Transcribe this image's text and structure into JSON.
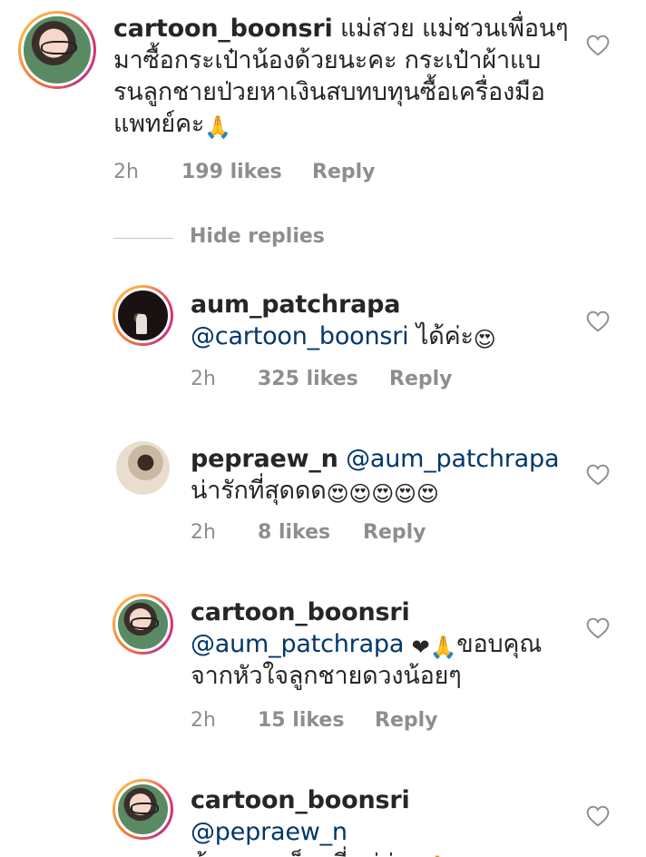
{
  "comments": [
    {
      "username": "cartoon_boonsri",
      "text_line1": "แม่สวย แม่ชวนเพื่อนๆ",
      "text_line2": "มาซื้อกระเป๋าน้องด้วยนะคะ กระเป๋าผ้าแบ",
      "text_line3": "รนลูกชายป่วยหาเงินสบทบทุนซื้อเครื่องมือ",
      "text_line4": "แพทย์คะ",
      "emoji": "🙏",
      "time": "2h",
      "likes": "199 likes",
      "reply": "Reply",
      "avatar": "cartoon-avatar-icon"
    },
    {
      "username": "aum_patchrapa",
      "mention": "@cartoon_boonsri",
      "text": "ได้ค่ะ",
      "emoji": "😍",
      "time": "2h",
      "likes": "325 likes",
      "reply": "Reply",
      "avatar": "aum-avatar-icon"
    },
    {
      "username": "pepraew_n",
      "mention": "@aum_patchrapa",
      "text": "น่ารักที่สุดดด",
      "emoji": "😍😍😍😍😍",
      "time": "2h",
      "likes": "8 likes",
      "reply": "Reply",
      "avatar": "pepraew-avatar-icon"
    },
    {
      "username": "cartoon_boonsri",
      "mention": "@aum_patchrapa",
      "emoji": "❤🙏",
      "text_line1": "ขอบคุณ",
      "text_line2": "จากหัวใจลูกชายดวงน้อยๆ",
      "time": "2h",
      "likes": "15 likes",
      "reply": "Reply",
      "avatar": "cartoon-avatar-icon"
    },
    {
      "username": "cartoon_boonsri",
      "mention": "@pepraew_n",
      "text": "ข้อความเล็กๆที่แม่อ่าน",
      "emoji": "🙏",
      "avatar": "cartoon-avatar-icon"
    }
  ],
  "hide_replies": "Hide replies",
  "colors": {
    "text": "#262626",
    "muted": "#8e8e8e",
    "mention": "#00376b",
    "divider": "#c7c7c7"
  },
  "icons": [
    "heart-outline-icon"
  ]
}
